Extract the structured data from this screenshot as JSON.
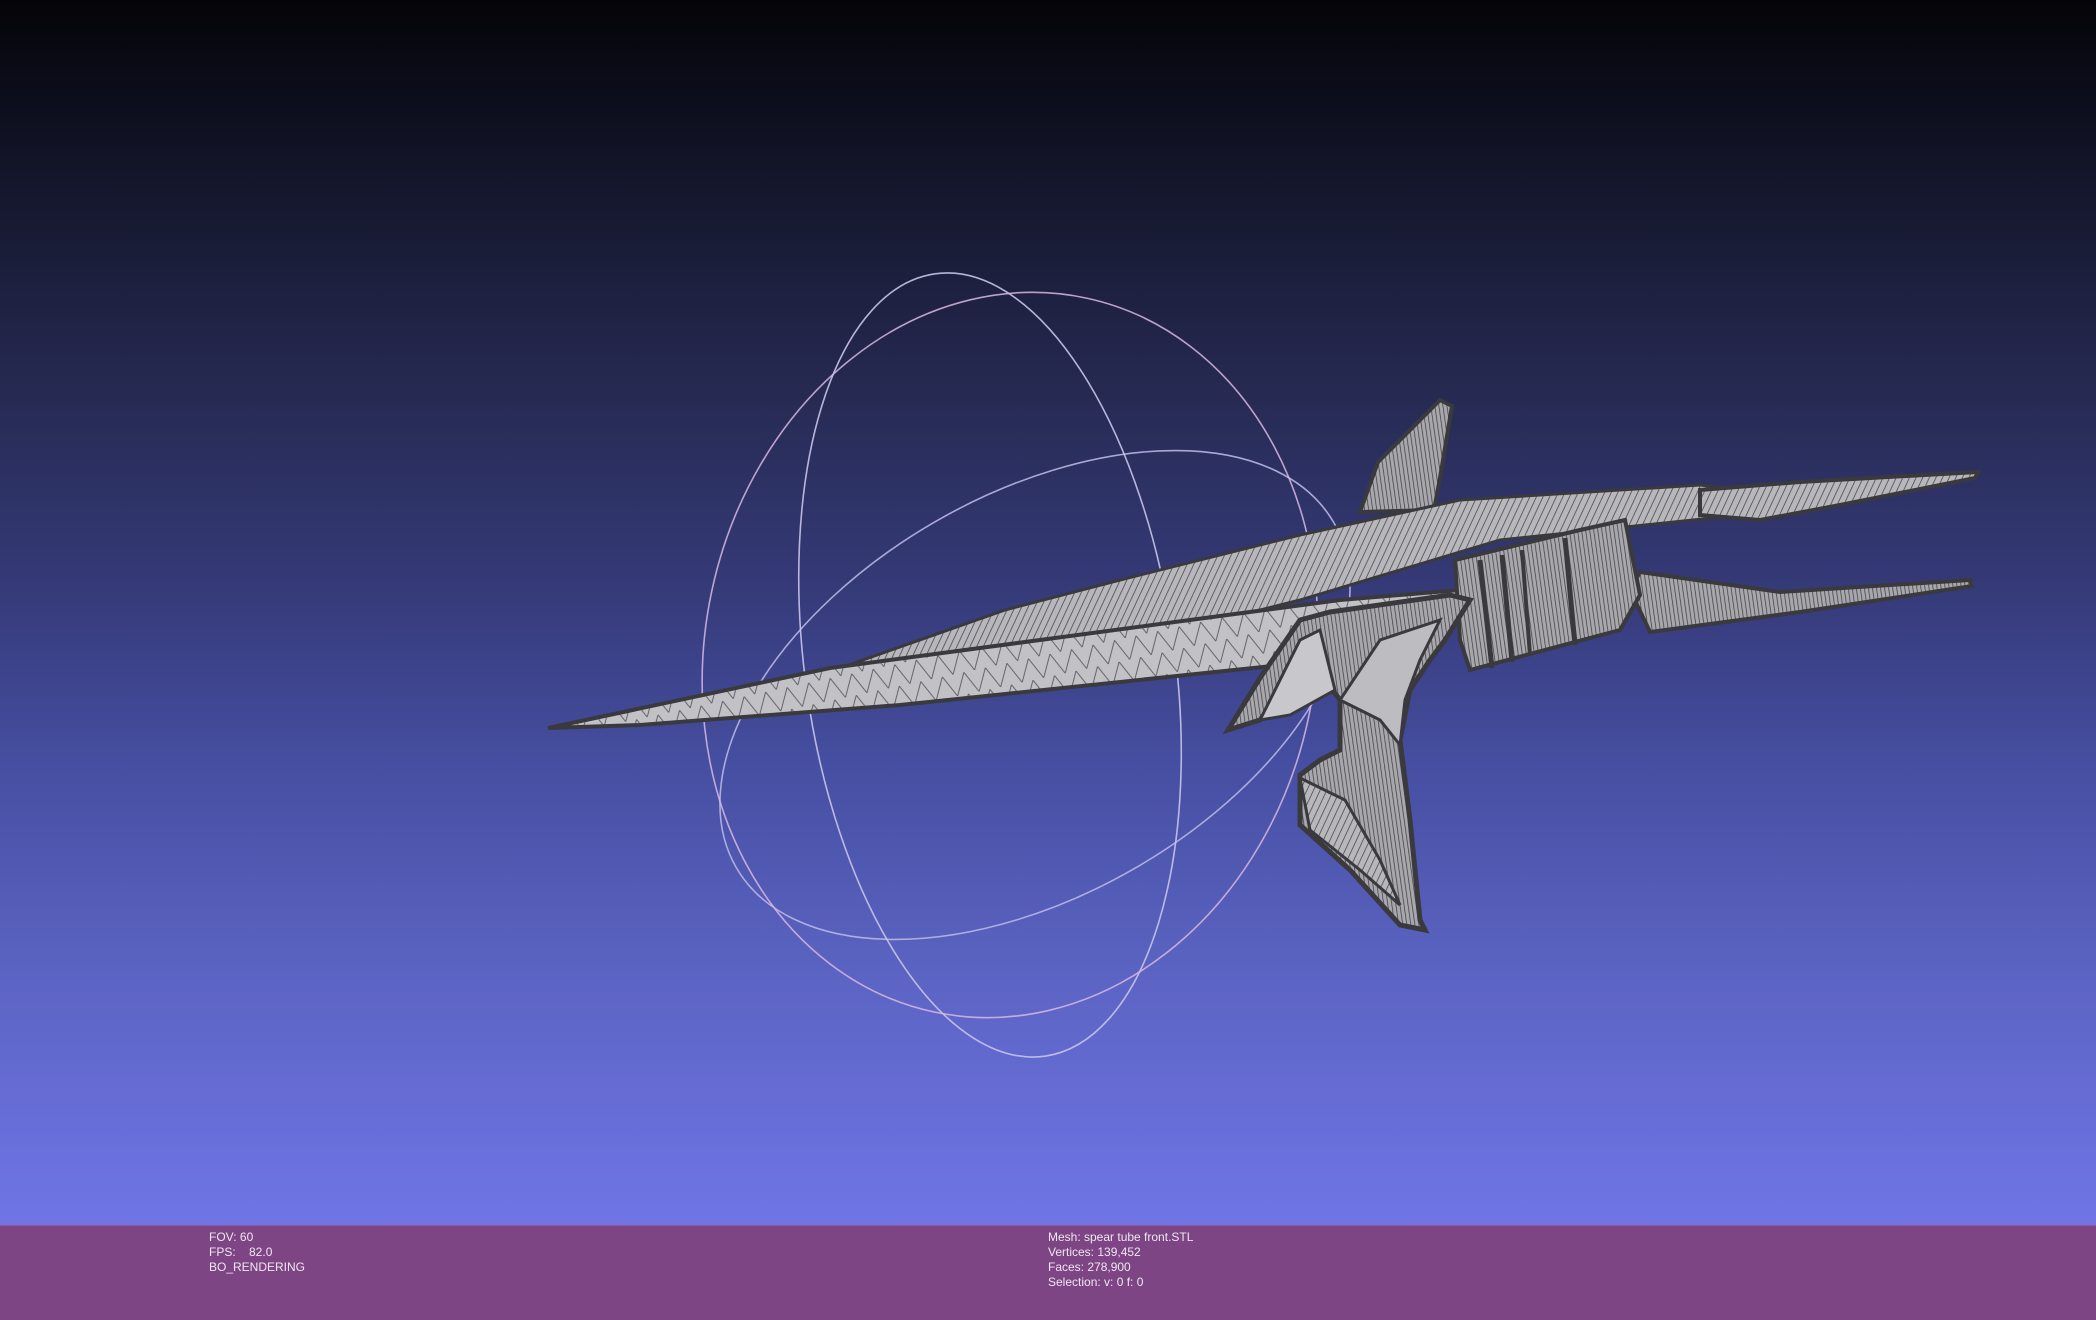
{
  "viewer": {
    "colors": {
      "background_top": "#040408",
      "background_bottom": "#7075e6",
      "info_bar": "#7e4585",
      "mesh_fill": "#b4b4b8",
      "mesh_edge": "#3c3c40",
      "trackball": "#d8d0e8"
    },
    "model": "spear-tube-front-wireframe",
    "trackball_visible": true
  },
  "info_left": {
    "fov": "FOV: 60",
    "fps": "FPS:    82.0",
    "render_mode": "BO_RENDERING"
  },
  "info_right": {
    "mesh": "Mesh: spear tube front.STL",
    "vertices": "Vertices: 139,452",
    "faces": "Faces: 278,900",
    "selection": "Selection: v: 0 f: 0"
  }
}
